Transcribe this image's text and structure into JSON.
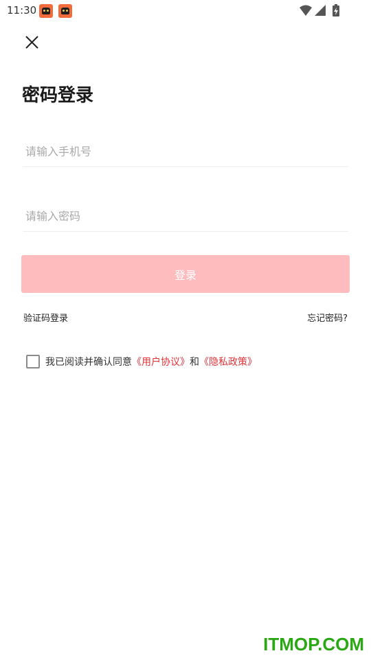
{
  "status_bar": {
    "time": "11:30"
  },
  "icons": {
    "notification": "app-notification-icon",
    "wifi": "wifi-icon",
    "signal": "signal-icon",
    "battery": "battery-charging-icon",
    "close": "close-icon"
  },
  "page": {
    "title": "密码登录"
  },
  "form": {
    "phone_placeholder": "请输入手机号",
    "phone_value": "",
    "password_placeholder": "请输入密码",
    "password_value": "",
    "login_label": "登录",
    "sms_login_label": "验证码登录",
    "forgot_password_label": "忘记密码?"
  },
  "agreement": {
    "checked": false,
    "prefix": "我已阅读并确认同意",
    "user_agreement": "《用户协议》",
    "conjunction": "和",
    "privacy_policy": "《隐私政策》"
  },
  "colors": {
    "login_button": "#ffbcbf",
    "link_red": "#e2323a",
    "watermark_green": "#2aa814"
  },
  "watermark": {
    "text": "ITMOP.COM"
  }
}
